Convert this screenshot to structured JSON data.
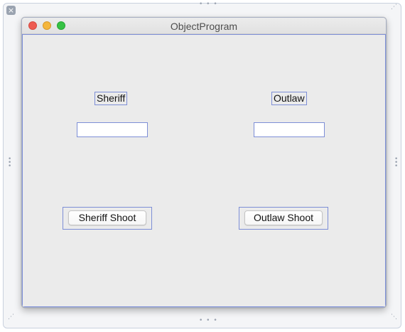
{
  "canvas": {
    "close_symbol": "×",
    "resize_handle_icon": "grip-dots"
  },
  "window": {
    "title": "ObjectProgram",
    "traffic_lights": {
      "close_color": "#ee5c52",
      "minimize_color": "#f4b63c",
      "zoom_color": "#36c244"
    }
  },
  "sheriff": {
    "label": "Sheriff",
    "field_value": "",
    "button_label": "Sheriff Shoot"
  },
  "outlaw": {
    "label": "Outlaw",
    "field_value": "",
    "button_label": "Outlaw Shoot"
  },
  "colors": {
    "selection_outline": "#7d8ed6",
    "window_background": "#ebebeb"
  }
}
